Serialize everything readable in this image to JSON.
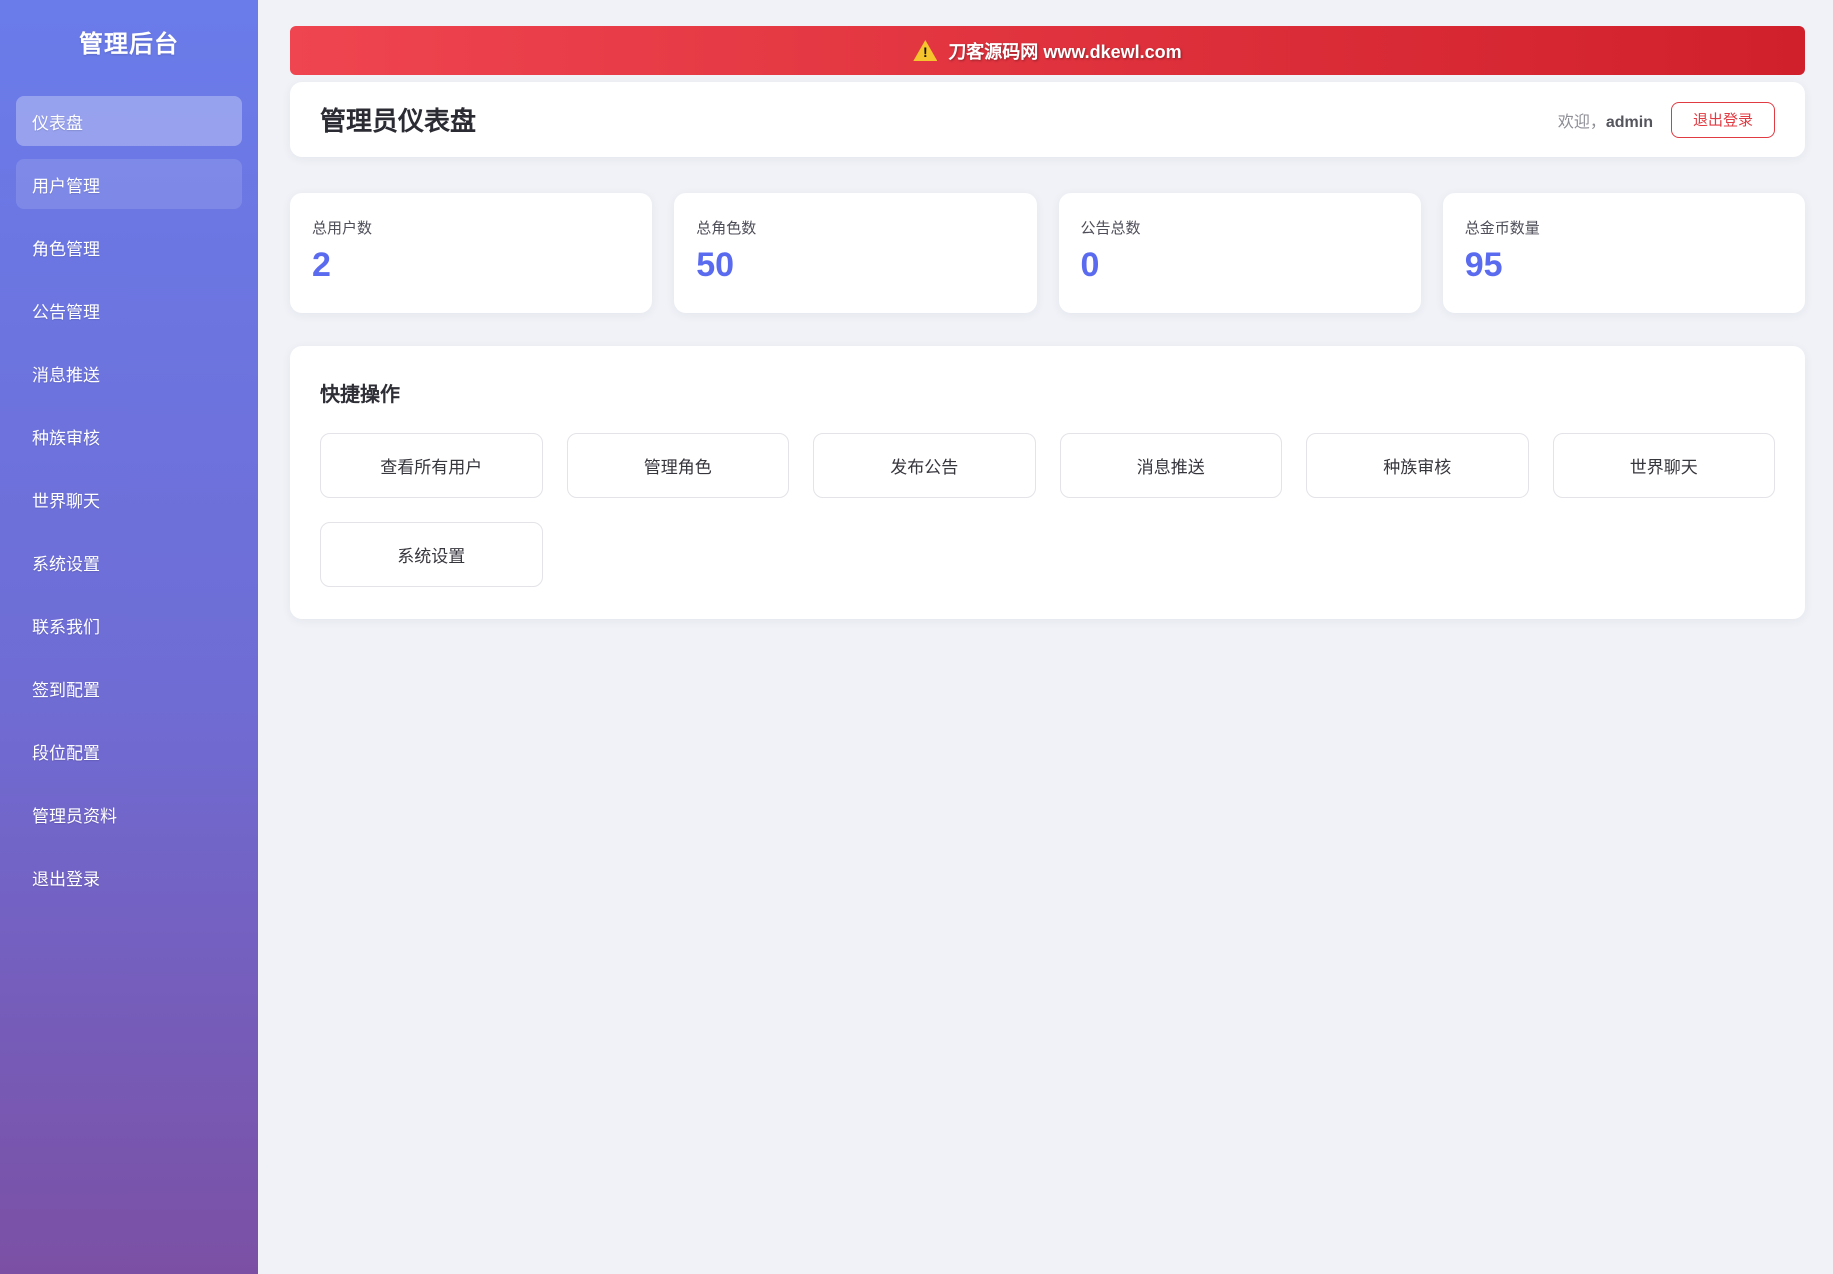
{
  "sidebar": {
    "title": "管理后台",
    "items": [
      {
        "label": "仪表盘",
        "state": "active"
      },
      {
        "label": "用户管理",
        "state": "highlight"
      },
      {
        "label": "角色管理",
        "state": "normal"
      },
      {
        "label": "公告管理",
        "state": "normal"
      },
      {
        "label": "消息推送",
        "state": "normal"
      },
      {
        "label": "种族审核",
        "state": "normal"
      },
      {
        "label": "世界聊天",
        "state": "normal"
      },
      {
        "label": "系统设置",
        "state": "normal"
      },
      {
        "label": "联系我们",
        "state": "normal"
      },
      {
        "label": "签到配置",
        "state": "normal"
      },
      {
        "label": "段位配置",
        "state": "normal"
      },
      {
        "label": "管理员资料",
        "state": "normal"
      },
      {
        "label": "退出登录",
        "state": "normal"
      }
    ]
  },
  "banner": {
    "text": "刀客源码网 www.dkewl.com",
    "icon": "warning-triangle",
    "background": "#e23340"
  },
  "header": {
    "title": "管理员仪表盘",
    "welcome_prefix": "欢迎，",
    "username": "admin",
    "logout_label": "退出登录"
  },
  "stats": [
    {
      "label": "总用户数",
      "value": "2"
    },
    {
      "label": "总角色数",
      "value": "50"
    },
    {
      "label": "公告总数",
      "value": "0"
    },
    {
      "label": "总金币数量",
      "value": "95"
    }
  ],
  "quick_actions": {
    "title": "快捷操作",
    "buttons": [
      "查看所有用户",
      "管理角色",
      "发布公告",
      "消息推送",
      "种族审核",
      "世界聊天",
      "系统设置"
    ]
  },
  "colors": {
    "accent_blue": "#5b6bf0",
    "banner_red": "#e23340",
    "logout_red": "#e03a42",
    "sidebar_gradient_top": "#6a7cea",
    "sidebar_gradient_bottom": "#7b50a4"
  }
}
